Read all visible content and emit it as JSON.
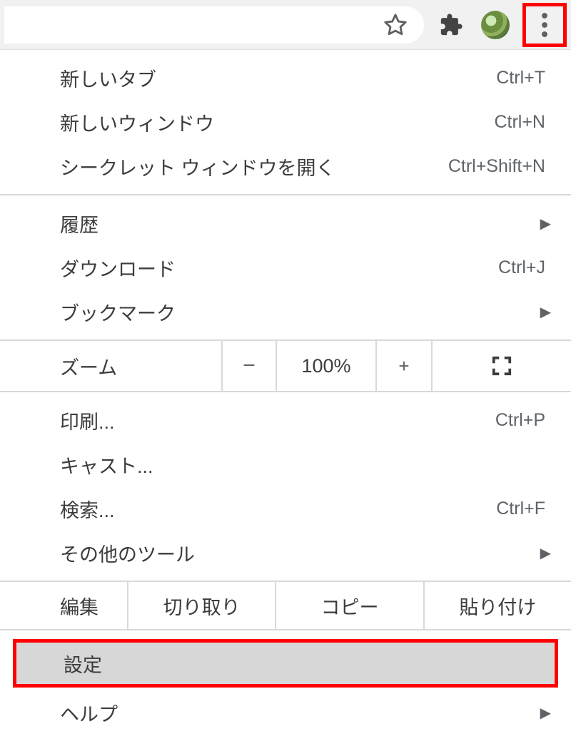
{
  "toolbar": {
    "star_icon": "star-icon",
    "extensions_icon": "puzzle-icon",
    "avatar": "avatar",
    "more_icon": "more-vert-icon"
  },
  "menu": {
    "section1": [
      {
        "label": "新しいタブ",
        "shortcut": "Ctrl+T",
        "arrow": ""
      },
      {
        "label": "新しいウィンドウ",
        "shortcut": "Ctrl+N",
        "arrow": ""
      },
      {
        "label": "シークレット ウィンドウを開く",
        "shortcut": "Ctrl+Shift+N",
        "arrow": ""
      }
    ],
    "section2": [
      {
        "label": "履歴",
        "shortcut": "",
        "arrow": "▶"
      },
      {
        "label": "ダウンロード",
        "shortcut": "Ctrl+J",
        "arrow": ""
      },
      {
        "label": "ブックマーク",
        "shortcut": "",
        "arrow": "▶"
      }
    ],
    "zoom": {
      "label": "ズーム",
      "minus": "−",
      "value": "100%",
      "plus": "+",
      "fullscreen_icon": "fullscreen-icon"
    },
    "section4": [
      {
        "label": "印刷...",
        "shortcut": "Ctrl+P",
        "arrow": ""
      },
      {
        "label": "キャスト...",
        "shortcut": "",
        "arrow": ""
      },
      {
        "label": "検索...",
        "shortcut": "Ctrl+F",
        "arrow": ""
      },
      {
        "label": "その他のツール",
        "shortcut": "",
        "arrow": "▶"
      }
    ],
    "edit": {
      "label": "編集",
      "cut": "切り取り",
      "copy": "コピー",
      "paste": "貼り付け"
    },
    "section6": {
      "settings": "設定",
      "help": {
        "label": "ヘルプ",
        "arrow": "▶"
      }
    }
  }
}
